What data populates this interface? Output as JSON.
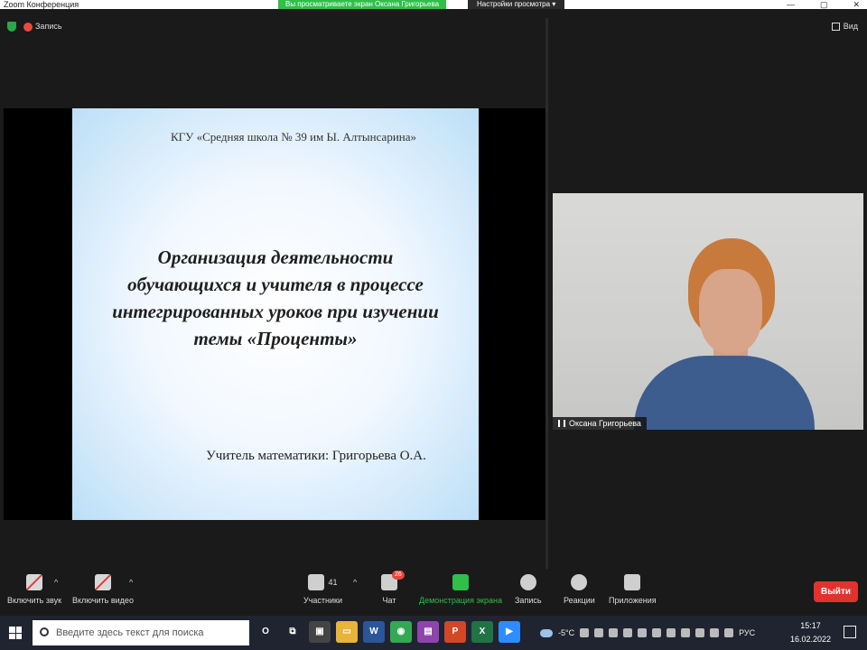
{
  "window": {
    "title": "Zoom Конференция",
    "controls": [
      "—",
      "▢",
      "✕"
    ]
  },
  "banner": {
    "sharing": "Вы просматриваете экран Оксана Григорьева",
    "view_settings": "Настройки просмотра ▾"
  },
  "top": {
    "record": "Запись",
    "view": "Вид"
  },
  "slide": {
    "school": "КГУ «Средняя школа № 39 им Ы. Алтынсарина»",
    "topic_lines": [
      "Организация деятельности",
      "обучающихся и учителя в процессе",
      "интегрированных уроков при изучении",
      "темы «Проценты»"
    ],
    "teacher": "Учитель математики: Григорьева О.А."
  },
  "participant": {
    "name": "Оксана Григорьева"
  },
  "toolbar": {
    "audio": "Включить звук",
    "video": "Включить видео",
    "participants": "Участники",
    "participants_count": "41",
    "chat": "Чат",
    "chat_badge": "26",
    "share": "Демонстрация экрана",
    "record": "Запись",
    "reactions": "Реакции",
    "apps": "Приложения",
    "leave": "Выйти"
  },
  "taskbar": {
    "search_placeholder": "Введите здесь текст для поиска",
    "weather": "-5°C",
    "lang": "РУС",
    "time": "15:17",
    "date": "16.02.2022",
    "apps": [
      {
        "name": "cortana",
        "glyph": "O",
        "color": "#1f2430"
      },
      {
        "name": "task-view",
        "glyph": "⧉",
        "color": "#1f2430"
      },
      {
        "name": "app-1",
        "glyph": "▣",
        "color": "#444"
      },
      {
        "name": "explorer",
        "glyph": "▭",
        "color": "#e8b43a"
      },
      {
        "name": "word",
        "glyph": "W",
        "color": "#2b579a"
      },
      {
        "name": "chrome",
        "glyph": "◉",
        "color": "#34a853"
      },
      {
        "name": "app-2",
        "glyph": "▤",
        "color": "#8e44ad"
      },
      {
        "name": "powerpoint",
        "glyph": "P",
        "color": "#d24726"
      },
      {
        "name": "excel",
        "glyph": "X",
        "color": "#217346"
      },
      {
        "name": "zoom",
        "glyph": "▶",
        "color": "#2d8cff"
      }
    ]
  }
}
